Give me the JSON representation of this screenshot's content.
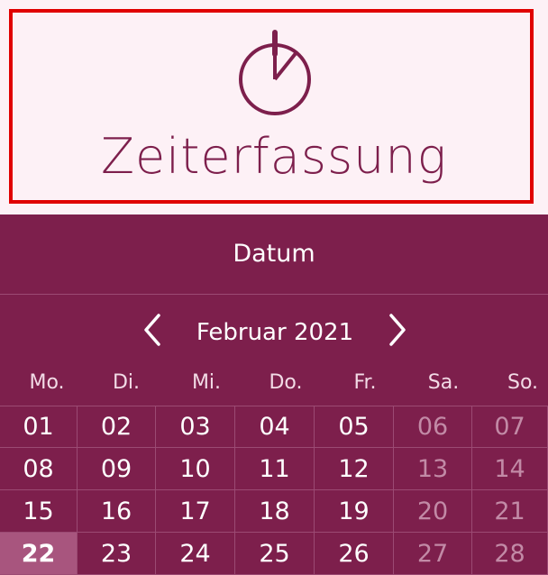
{
  "header": {
    "title": "Zeiterfassung",
    "icon": "stopwatch-icon"
  },
  "datepicker": {
    "heading": "Datum",
    "month_label": "Februar 2021",
    "prev_icon": "chevron-left-icon",
    "next_icon": "chevron-right-icon",
    "weekdays": [
      "Mo.",
      "Di.",
      "Mi.",
      "Do.",
      "Fr.",
      "Sa.",
      "So."
    ],
    "weeks": [
      [
        "01",
        "02",
        "03",
        "04",
        "05",
        "06",
        "07"
      ],
      [
        "08",
        "09",
        "10",
        "11",
        "12",
        "13",
        "14"
      ],
      [
        "15",
        "16",
        "17",
        "18",
        "19",
        "20",
        "21"
      ],
      [
        "22",
        "23",
        "24",
        "25",
        "26",
        "27",
        "28"
      ]
    ],
    "selected_day": "22"
  },
  "colors": {
    "primary": "#7d1f4c",
    "header_bg": "#fdf1f6",
    "frame": "#e00000"
  }
}
